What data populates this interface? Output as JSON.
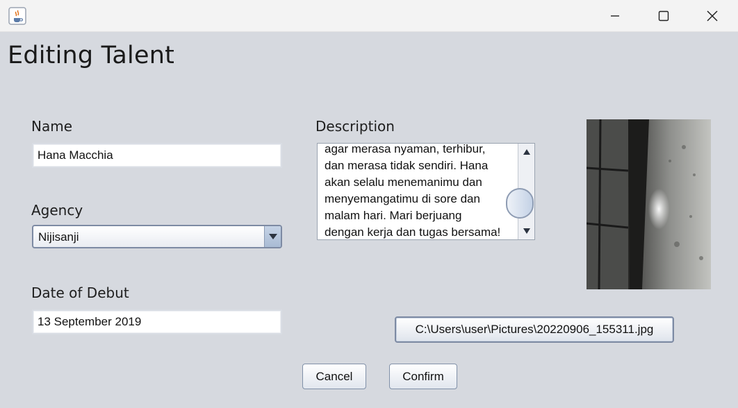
{
  "window": {
    "controls": {
      "minimize_icon": "minimize-icon",
      "maximize_icon": "maximize-icon",
      "close_icon": "close-icon"
    },
    "app_icon": "java-coffee-cup-icon"
  },
  "page_title": "Editing Talent",
  "form": {
    "name": {
      "label": "Name",
      "value": "Hana Macchia"
    },
    "agency": {
      "label": "Agency",
      "selected": "Nijisanji"
    },
    "debut": {
      "label": "Date of Debut",
      "value": "13 September 2019"
    },
    "description": {
      "label": "Description",
      "visible_text": "agar merasa nyaman, terhibur,\ndan merasa tidak sendiri. Hana\nakan selalu menemanimu dan\nmenyemangatimu di sore dan\nmalam hari. Mari berjuang\ndengan kerja dan tugas bersama!"
    },
    "image_path": "C:\\Users\\user\\Pictures\\20220906_155311.jpg"
  },
  "actions": {
    "cancel": "Cancel",
    "confirm": "Confirm"
  },
  "colors": {
    "background": "#d6d9df",
    "titlebar": "#f3f3f3",
    "accent_border": "#7d8aa3"
  }
}
